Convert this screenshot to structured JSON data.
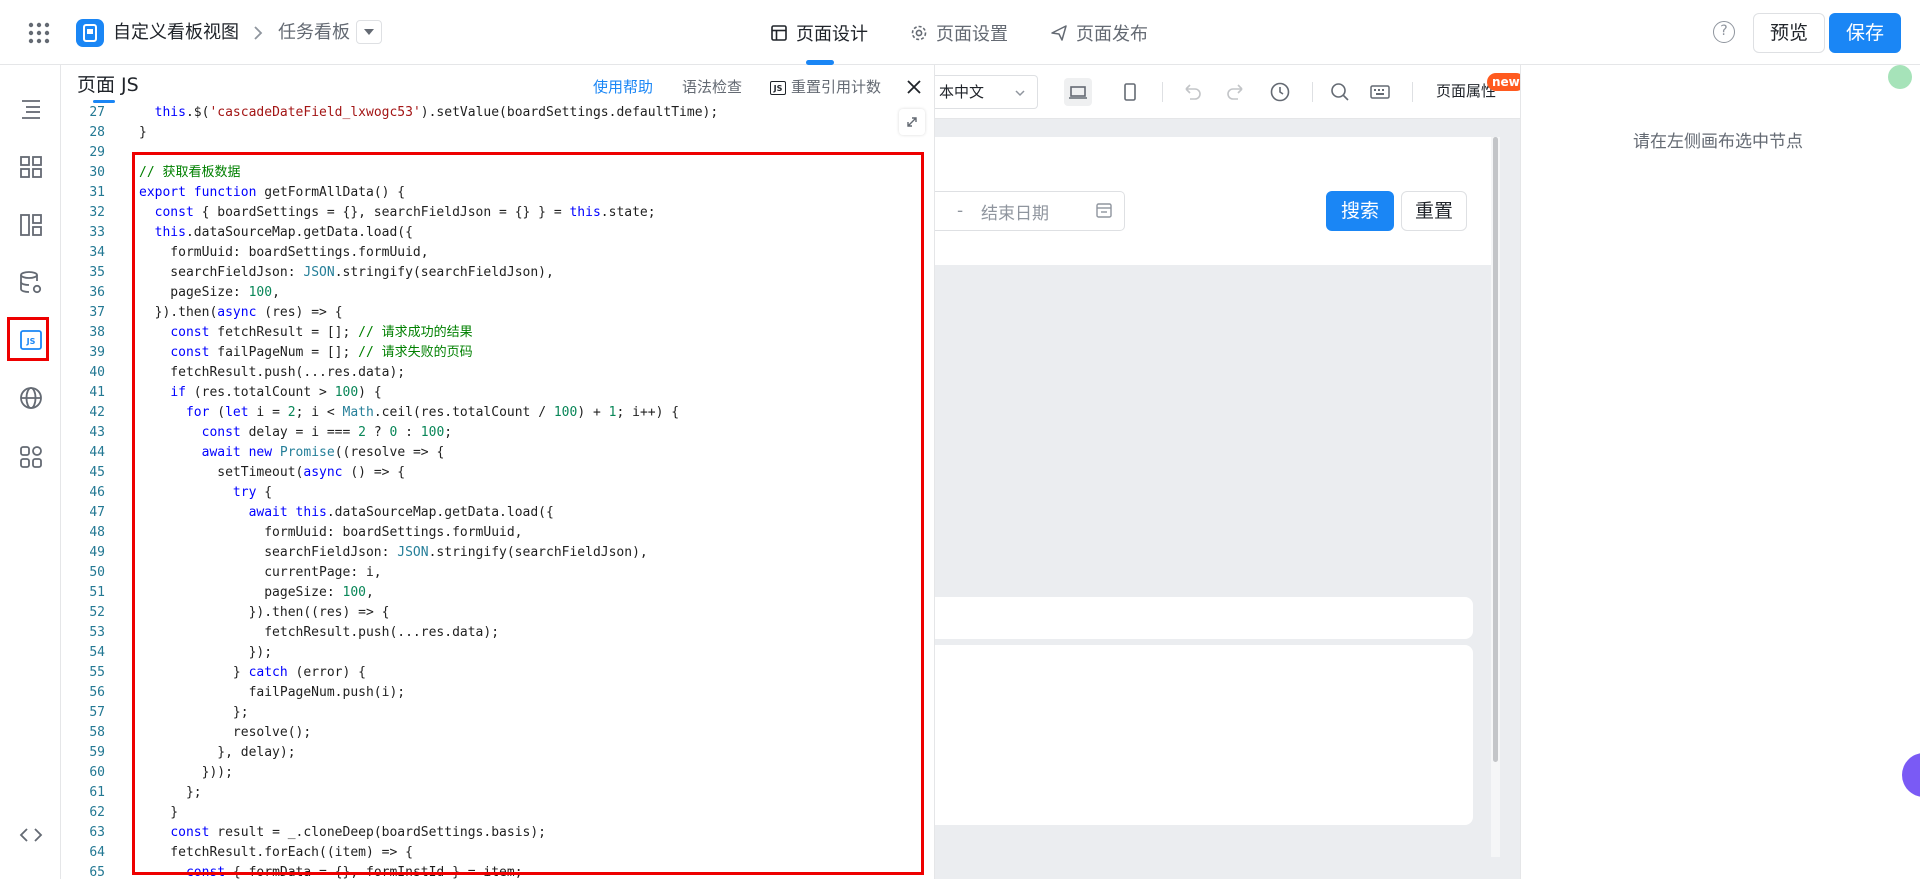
{
  "header": {
    "breadcrumb_app": "自定义看板视图",
    "breadcrumb_page": "任务看板",
    "tabs": [
      {
        "label": "页面设计",
        "active": true
      },
      {
        "label": "页面设置",
        "active": false
      },
      {
        "label": "页面发布",
        "active": false
      }
    ],
    "help_label": "?",
    "preview_label": "预览",
    "save_label": "保存"
  },
  "rail": {
    "icons": [
      "outline-icon",
      "components-icon",
      "layout-icon",
      "datasource-icon",
      "js-icon",
      "globe-icon",
      "apps-icon"
    ],
    "js_label": "JS",
    "bottom_icon": "code-icon"
  },
  "js_panel": {
    "title": "页面 JS",
    "help_link": "使用帮助",
    "lint_label": "语法检查",
    "reset_badge": "JS",
    "reset_label": "重置引用计数",
    "close_icon": "close-icon",
    "code_lines": [
      {
        "n": "27",
        "t": "  this.$('cascadeDateField_lxwogc53').setValue(boardSettings.defaultTime);"
      },
      {
        "n": "28",
        "t": "}"
      },
      {
        "n": "29",
        "t": ""
      },
      {
        "n": "30",
        "t": "// 获取看板数据"
      },
      {
        "n": "31",
        "t": "export function getFormAllData() {"
      },
      {
        "n": "32",
        "t": "  const { boardSettings = {}, searchFieldJson = {} } = this.state;"
      },
      {
        "n": "33",
        "t": "  this.dataSourceMap.getData.load({"
      },
      {
        "n": "34",
        "t": "    formUuid: boardSettings.formUuid,"
      },
      {
        "n": "35",
        "t": "    searchFieldJson: JSON.stringify(searchFieldJson),"
      },
      {
        "n": "36",
        "t": "    pageSize: 100,"
      },
      {
        "n": "37",
        "t": "  }).then(async (res) => {"
      },
      {
        "n": "38",
        "t": "    const fetchResult = []; // 请求成功的结果"
      },
      {
        "n": "39",
        "t": "    const failPageNum = []; // 请求失败的页码"
      },
      {
        "n": "40",
        "t": "    fetchResult.push(...res.data);"
      },
      {
        "n": "41",
        "t": "    if (res.totalCount > 100) {"
      },
      {
        "n": "42",
        "t": "      for (let i = 2; i < Math.ceil(res.totalCount / 100) + 1; i++) {"
      },
      {
        "n": "43",
        "t": "        const delay = i === 2 ? 0 : 100;"
      },
      {
        "n": "44",
        "t": "        await new Promise((resolve => {"
      },
      {
        "n": "45",
        "t": "          setTimeout(async () => {"
      },
      {
        "n": "46",
        "t": "            try {"
      },
      {
        "n": "47",
        "t": "              await this.dataSourceMap.getData.load({"
      },
      {
        "n": "48",
        "t": "                formUuid: boardSettings.formUuid,"
      },
      {
        "n": "49",
        "t": "                searchFieldJson: JSON.stringify(searchFieldJson),"
      },
      {
        "n": "50",
        "t": "                currentPage: i,"
      },
      {
        "n": "51",
        "t": "                pageSize: 100,"
      },
      {
        "n": "52",
        "t": "              }).then((res) => {"
      },
      {
        "n": "53",
        "t": "                fetchResult.push(...res.data);"
      },
      {
        "n": "54",
        "t": "              });"
      },
      {
        "n": "55",
        "t": "            } catch (error) {"
      },
      {
        "n": "56",
        "t": "              failPageNum.push(i);"
      },
      {
        "n": "57",
        "t": "            };"
      },
      {
        "n": "58",
        "t": "            resolve();"
      },
      {
        "n": "59",
        "t": "          }, delay);"
      },
      {
        "n": "60",
        "t": "        }));"
      },
      {
        "n": "61",
        "t": "      };"
      },
      {
        "n": "62",
        "t": "    }"
      },
      {
        "n": "63",
        "t": "    const result = _.cloneDeep(boardSettings.basis);"
      },
      {
        "n": "64",
        "t": "    fetchResult.forEach((item) => {"
      },
      {
        "n": "65",
        "t": "      const { formData = {}, formInstId } = item;"
      }
    ]
  },
  "canvas": {
    "language": "本中文",
    "page_props_label": "页面属性",
    "new_badge": "new",
    "date_separator": "-",
    "date_end_placeholder": "结束日期",
    "search_label": "搜索",
    "reset_label": "重置"
  },
  "right_panel": {
    "hint": "请在左侧画布选中节点"
  },
  "colors": {
    "accent": "#1a86f5",
    "highlight": "#ee0000",
    "new_badge": "#ff5a1f",
    "comment": "#008000",
    "keyword": "#0000ff",
    "string": "#a31515",
    "number": "#098658",
    "builtin": "#267f99"
  }
}
